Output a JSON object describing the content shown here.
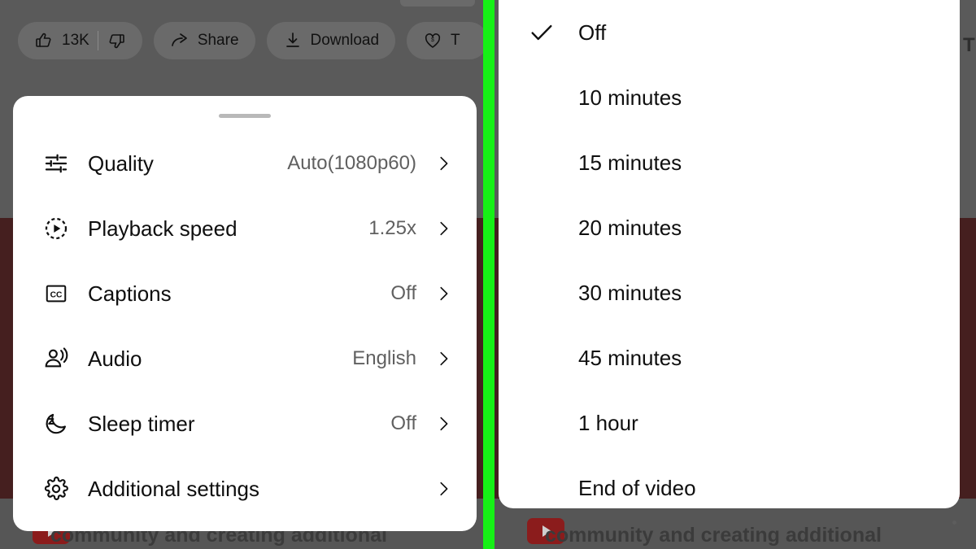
{
  "colors": {
    "divider_green": "#16f016",
    "sheet_background": "#ffffff",
    "dim_overlay_gray": "#5a5a5a",
    "dim_overlay_maroon": "#451f1f",
    "primary_text": "#0f0f0f",
    "secondary_text": "#606060",
    "drag_handle": "#b9b9b9"
  },
  "action_bar": {
    "like_button": {
      "icon": "thumbs-up-icon",
      "count": "13K"
    },
    "dislike_button": {
      "icon": "thumbs-down-icon",
      "label": ""
    },
    "share_button": {
      "icon": "share-arrow-icon",
      "label": "Share"
    },
    "download_button": {
      "icon": "download-icon",
      "label": "Download"
    },
    "thanks_button": {
      "icon": "heart-dollar-icon",
      "label": "T"
    }
  },
  "background": {
    "description_text": "community and creating additional",
    "stray_label": "Th",
    "channel_badge_icon": "youtube-play-icon"
  },
  "settings_sheet": {
    "drag_handle": "drag-handle",
    "items": [
      {
        "icon": "tune-sliders-icon",
        "label": "Quality",
        "value": "Auto(1080p60)",
        "chevron": "chevron-right-icon"
      },
      {
        "icon": "playback-speed-icon",
        "label": "Playback speed",
        "value": "1.25x",
        "chevron": "chevron-right-icon"
      },
      {
        "icon": "closed-captions-icon",
        "label": "Captions",
        "value": "Off",
        "chevron": "chevron-right-icon"
      },
      {
        "icon": "audio-person-icon",
        "label": "Audio",
        "value": "English",
        "chevron": "chevron-right-icon"
      },
      {
        "icon": "sleep-timer-moon-icon",
        "label": "Sleep timer",
        "value": "Off",
        "chevron": "chevron-right-icon"
      },
      {
        "icon": "gear-icon",
        "label": "Additional settings",
        "value": "",
        "chevron": "chevron-right-icon"
      }
    ]
  },
  "sleep_timer_sheet": {
    "selected": "Off",
    "options": [
      {
        "label": "Off",
        "checked": true
      },
      {
        "label": "10 minutes",
        "checked": false
      },
      {
        "label": "15 minutes",
        "checked": false
      },
      {
        "label": "20 minutes",
        "checked": false
      },
      {
        "label": "30 minutes",
        "checked": false
      },
      {
        "label": "45 minutes",
        "checked": false
      },
      {
        "label": "1 hour",
        "checked": false
      },
      {
        "label": "End of video",
        "checked": false
      }
    ]
  }
}
